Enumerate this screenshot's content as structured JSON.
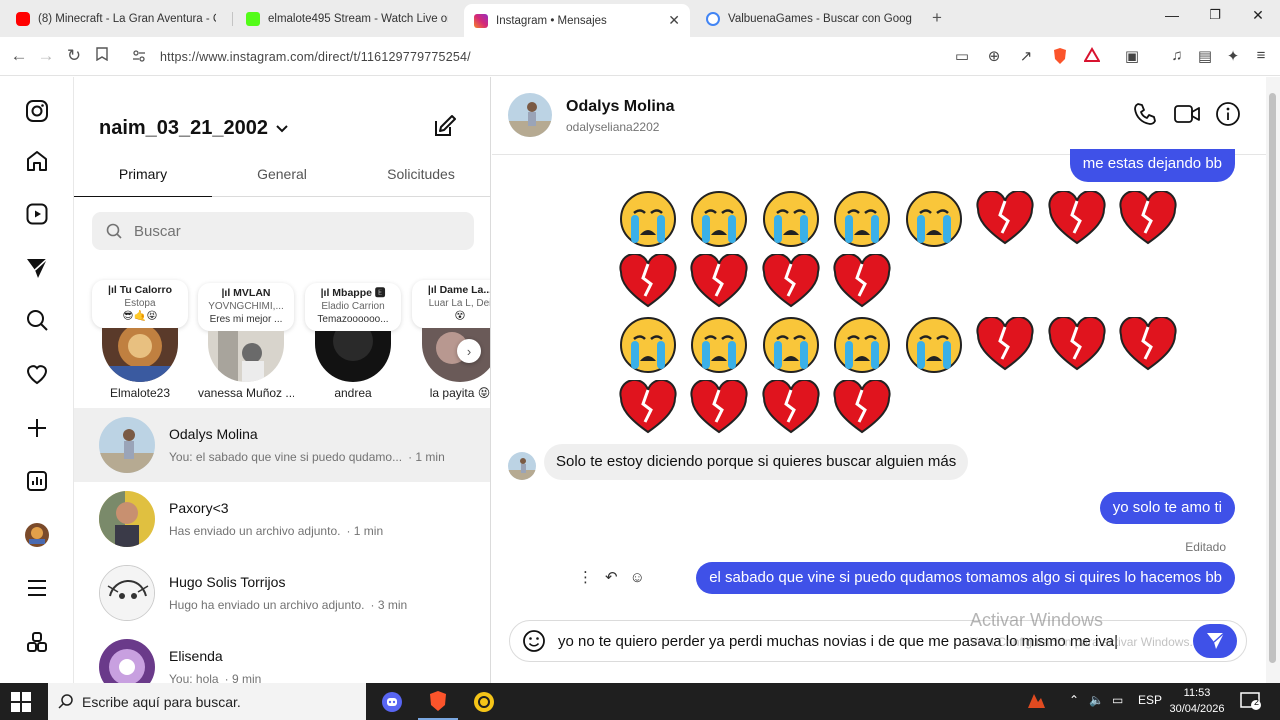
{
  "browser": {
    "tabs": [
      {
        "title": "(8) Minecraft - La Gran Aventura - Ca",
        "favicon_color": "#ff0000"
      },
      {
        "title": "elmalote495 Stream - Watch Live on",
        "favicon_color": "#53fc18"
      },
      {
        "title": "Instagram • Mensajes",
        "favicon_color": "#d62976"
      },
      {
        "title": "ValbuenaGames - Buscar con Google",
        "favicon_color": "#4285f4"
      }
    ],
    "url": "https://www.instagram.com/direct/t/116129779775254/"
  },
  "inbox": {
    "account": "naim_03_21_2002",
    "tabs": [
      "Primary",
      "General",
      "Solicitudes"
    ],
    "search_placeholder": "Buscar",
    "notes": [
      {
        "song": "|ıl Tu Calorro",
        "artist": "Estopa",
        "extra": "😎🤙😝",
        "name": "Elmalote23"
      },
      {
        "song": "|ıl MVLAN",
        "artist": "YOVNGCHIMI,...",
        "extra": "Eres mi mejor ...",
        "name": "vanessa Muñoz ..."
      },
      {
        "song": "|ıl Mbappe 🅴",
        "artist": "Eladio Carrion",
        "extra": "Temazoooooo...",
        "name": "andrea"
      },
      {
        "song": "|ıl Dame La...",
        "artist": "Luar La L, Dei",
        "extra": "😵",
        "name": "la payita 😝"
      }
    ],
    "threads": [
      {
        "name": "Odalys Molina",
        "preview": "You: el sabado que vine si puedo qudamo...",
        "time": "· 1 min"
      },
      {
        "name": "Paxory<3",
        "preview": "Has enviado un archivo adjunto.",
        "time": "· 1 min"
      },
      {
        "name": "Hugo Solis Torrijos",
        "preview": "Hugo ha enviado un archivo adjunto.",
        "time": "· 3 min"
      },
      {
        "name": "Elisenda",
        "preview": "You: hola",
        "time": "· 9 min"
      }
    ]
  },
  "chat": {
    "name": "Odalys Molina",
    "username": "odalyseliana2202",
    "messages": {
      "out_top": "me estas dejando bb",
      "in_1": "Solo te estoy diciendo porque si quieres buscar alguien más",
      "out_2": "yo solo te amo ti",
      "edited_label": "Editado",
      "out_3": "el sabado  que vine si puedo qudamos tomamos algo si quires lo hacemos bb"
    },
    "composer_text": "yo no te quiero perder ya perdi muchas novias i de que me pasava lo mismo me iva|",
    "watermark_title": "Activar Windows",
    "watermark_sub": "Ve a Configuración para activar Windows."
  },
  "taskbar": {
    "search_placeholder": "Escribe aquí para buscar.",
    "lang": "ESP",
    "time": "11:53",
    "date": "30/04/2026",
    "notif_count": "2"
  }
}
